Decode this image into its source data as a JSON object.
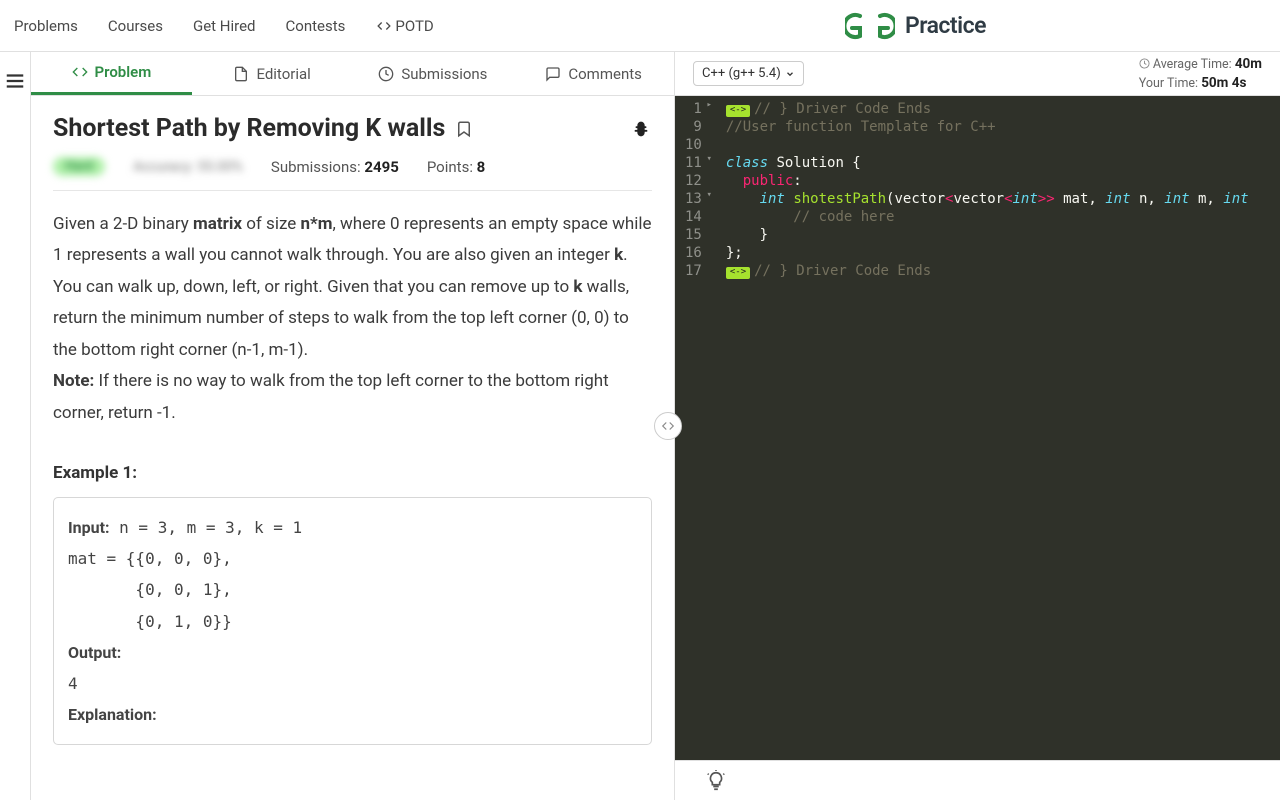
{
  "brand": {
    "name": "Practice"
  },
  "topnav": {
    "problems": "Problems",
    "courses": "Courses",
    "gethired": "Get Hired",
    "contests": "Contests",
    "potd": "POTD"
  },
  "tabs": {
    "problem": "Problem",
    "editorial": "Editorial",
    "submissions": "Submissions",
    "comments": "Comments"
  },
  "problem": {
    "title": "Shortest Path by Removing K walls",
    "difficulty_blur": "Hard",
    "accuracy_blur": "Accuracy: 55.00%",
    "submissions_label": "Submissions: ",
    "submissions_value": "2495",
    "points_label": "Points: ",
    "points_value": "8",
    "desc_html": "Given a 2-D binary <b>matrix</b> of size <b>n*m</b>, where 0 represents an empty space while 1 represents a wall you cannot walk through. You are also given an integer <b>k</b>.<br>You can walk up, down, left, or right. Given that you can remove up to <b>k</b> walls, return the minimum number of steps to walk from the top left corner (0, 0) to the bottom right corner (n-1, m-1).<br><b>Note:</b> If there is no way to walk from the top left corner to the bottom right corner, return -1.",
    "example_heading": "Example 1:",
    "example_body": "<b>Input:</b> n = 3, m = 3, k = 1\nmat = {{0, 0, 0},\n       {0, 0, 1},\n       {0, 1, 0}}\n<b>Output:</b>\n4\n<b>Explanation:</b>"
  },
  "editor": {
    "lang": "C++ (g++ 5.4)",
    "avg_label": "Average Time: ",
    "avg_value": "40m",
    "your_label": "Your Time: ",
    "your_value": "50m 4s",
    "lines": [
      {
        "n": 1,
        "fold": "closed",
        "html": "<span class='fold-marker'>&lt;-&gt;</span><span class='c-comment'>// } Driver Code Ends</span>"
      },
      {
        "n": 9,
        "html": "<span class='c-comment'>//User function Template for C++</span>"
      },
      {
        "n": 10,
        "html": ""
      },
      {
        "n": 11,
        "fold": "open",
        "html": "<span class='c-key'>class</span> <span class='c-plain'>Solution {</span>"
      },
      {
        "n": 12,
        "html": "  <span class='c-key2'>public</span><span class='c-plain'>:</span>"
      },
      {
        "n": 13,
        "fold": "open",
        "html": "    <span class='c-type'>int</span> <span class='c-func'>shotestPath</span><span class='c-plain'>(vector</span><span class='c-key2'>&lt;</span><span class='c-plain'>vector</span><span class='c-key2'>&lt;</span><span class='c-type'>int</span><span class='c-key2'>&gt;&gt;</span> <span class='c-plain'>mat, </span><span class='c-type'>int</span><span class='c-plain'> n, </span><span class='c-type'>int</span><span class='c-plain'> m, </span><span class='c-type'>int</span>"
      },
      {
        "n": 14,
        "html": "        <span class='c-comment'>// code here</span>"
      },
      {
        "n": 15,
        "html": "    <span class='c-plain'>}</span>"
      },
      {
        "n": 16,
        "html": "<span class='c-plain'>};</span>"
      },
      {
        "n": 17,
        "html": "<span class='fold-marker'>&lt;-&gt;</span><span class='c-comment'>// } Driver Code Ends</span>"
      }
    ]
  }
}
